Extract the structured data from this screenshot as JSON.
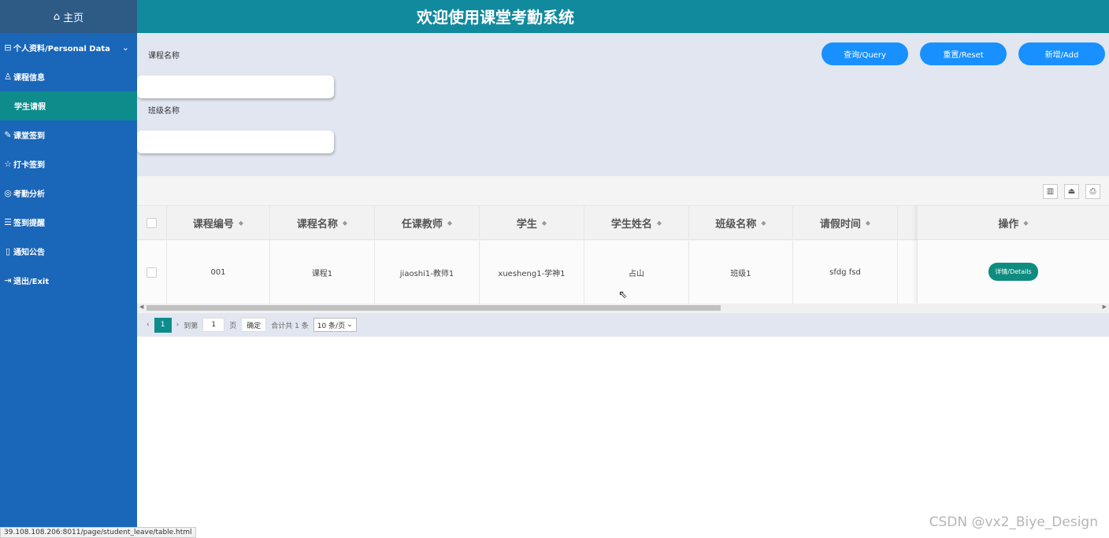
{
  "header": {
    "title": "欢迎使用课堂考勤系统"
  },
  "sidebar": {
    "home": "主页",
    "items": [
      {
        "label": "个人资料/Personal Data",
        "icon": "user-card-icon"
      },
      {
        "label": "课程信息",
        "icon": "user-icon"
      },
      {
        "label": "学生请假",
        "icon": ""
      },
      {
        "label": "课堂签到",
        "icon": "pencil-icon"
      },
      {
        "label": "打卡签到",
        "icon": "star-icon"
      },
      {
        "label": "考勤分析",
        "icon": "chart-icon"
      },
      {
        "label": "签到提醒",
        "icon": "list-icon"
      },
      {
        "label": "通知公告",
        "icon": "doc-icon"
      },
      {
        "label": "退出/Exit",
        "icon": "exit-icon"
      }
    ]
  },
  "search": {
    "course_label": "课程名称",
    "class_label": "班级名称",
    "query": "查询/Query",
    "reset": "重置/Reset",
    "add": "新增/Add"
  },
  "table": {
    "columns": [
      "课程编号",
      "课程名称",
      "任课教师",
      "学生",
      "学生姓名",
      "班级名称",
      "请假时间"
    ],
    "action_header": "操作",
    "rows": [
      {
        "cells": [
          "001",
          "课程1",
          "jiaoshi1-教师1",
          "xuesheng1-学神1",
          "占山",
          "班级1",
          "sfdg fsd"
        ],
        "action": "详情/Details"
      }
    ]
  },
  "pager": {
    "current": "1",
    "goto_label": "到第",
    "page_input": "1",
    "page_unit": "页",
    "confirm": "确定",
    "total": "合计共 1 条",
    "page_size": "10 条/页"
  },
  "status_url": "39.108.108.206:8011/page/student_leave/table.html",
  "watermark": "CSDN @vx2_Biye_Design"
}
